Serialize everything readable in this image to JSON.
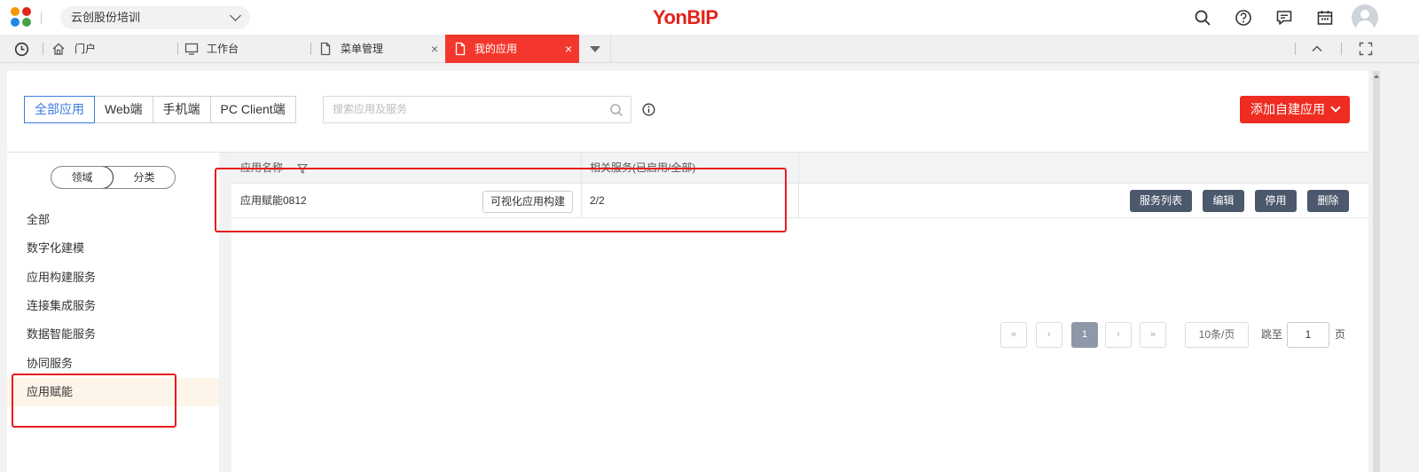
{
  "header": {
    "tenant": "云创股份培训",
    "brand": "YonBIP",
    "icons": [
      "search-icon",
      "help-icon",
      "message-icon",
      "calendar-icon",
      "user-avatar"
    ]
  },
  "tabs": [
    {
      "label": "门户",
      "icon": "home-icon"
    },
    {
      "label": "工作台",
      "icon": "monitor-icon"
    },
    {
      "label": "菜单管理",
      "icon": "document-icon",
      "closable": true
    },
    {
      "label": "我的应用",
      "icon": "document-icon",
      "closable": true,
      "active": true
    }
  ],
  "tab_close_glyph": "×",
  "toolbar": {
    "filters": [
      "全部应用",
      "Web端",
      "手机端",
      "PC Client端"
    ],
    "active_filter": "全部应用",
    "search_placeholder": "搜索应用及服务",
    "add_button": "添加自建应用"
  },
  "sidebar": {
    "toggle": [
      "领域",
      "分类"
    ],
    "categories": [
      "全部",
      "数字化建模",
      "应用构建服务",
      "连接集成服务",
      "数据智能服务",
      "协同服务",
      "应用赋能"
    ],
    "selected": "应用赋能"
  },
  "table": {
    "columns": [
      "应用名称",
      "相关服务(已启用/全部)"
    ],
    "rows": [
      {
        "name": "应用赋能0812",
        "tag": "可视化应用构建",
        "services": "2/2",
        "actions": [
          "服务列表",
          "编辑",
          "停用",
          "删除"
        ]
      }
    ]
  },
  "pagination": {
    "first": "«",
    "prev": "‹",
    "current": "1",
    "next": "›",
    "last": "»",
    "page_size": "10条/页",
    "jump_label": "跳至",
    "jump_value": "1",
    "page_suffix": "页"
  },
  "colors": {
    "brand_red": "#e2231a",
    "active_tab": "#f4372c",
    "primary_blue": "#3c7ce0",
    "action_button": "#4c586c",
    "highlight_box": "#e81c1c",
    "selected_row": "#fef5ea"
  }
}
